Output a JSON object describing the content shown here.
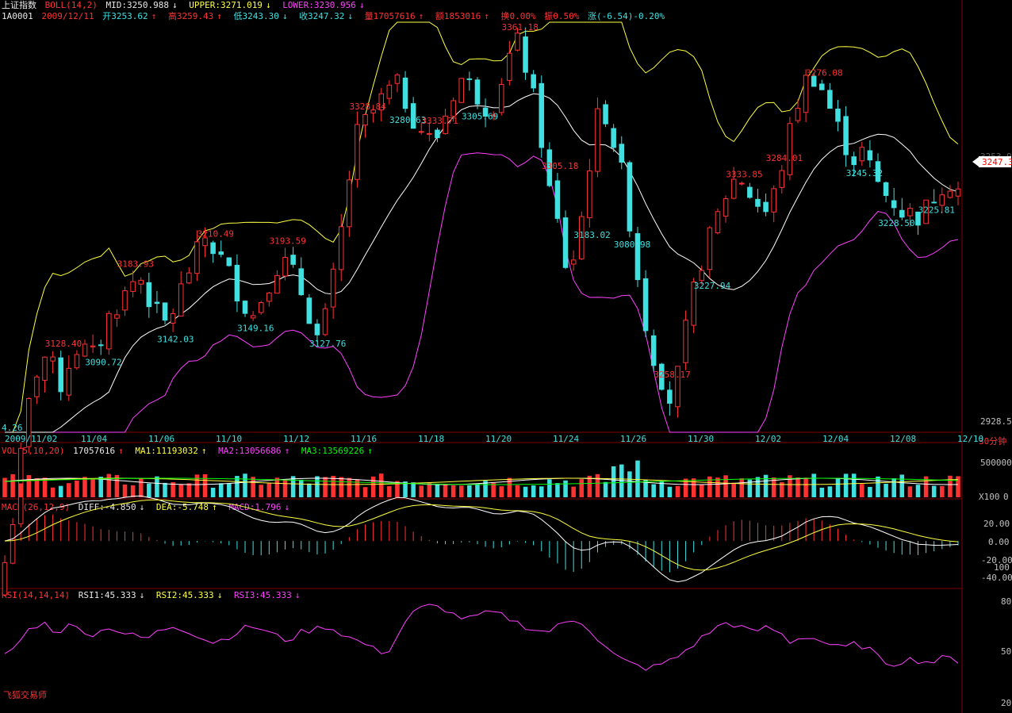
{
  "header1": {
    "name": "上证指数",
    "indicator": "BOLL(14,2)",
    "mid": "MID:3250.988",
    "mid_arrow": "↓",
    "upper": "UPPER:3271.019",
    "upper_arrow": "↓",
    "lower": "LOWER:3230.956",
    "lower_arrow": "↓"
  },
  "header2": {
    "code": "1A0001",
    "date": "2009/12/11",
    "open": "开3253.62",
    "open_arrow": "↑",
    "high": "高3259.43",
    "high_arrow": "↑",
    "low": "低3243.30",
    "low_arrow": "↓",
    "close": "收3247.32",
    "close_arrow": "↓",
    "volume": "量17057616",
    "volume_arrow": "↑",
    "amount": "额1853016",
    "amount_arrow": "↑",
    "turnover": "换0.00%",
    "amplitude": "振0.50%",
    "change": "涨(-6.54)-0.20%"
  },
  "vol_header": {
    "label": "VOL(5,10,20)",
    "value": "17057616",
    "value_arrow": "↑",
    "ma1": "MA1:11193032",
    "ma1_arrow": "↑",
    "ma2": "MA2:13056686",
    "ma2_arrow": "↑",
    "ma3": "MA3:13569226",
    "ma3_arrow": "↑"
  },
  "macd_header": {
    "label": "MACD(26,12,9)",
    "diff": "DIFF:-4.850",
    "diff_arrow": "↓",
    "dea": "DEA:-5.748",
    "dea_arrow": "↑",
    "macd": "MACD:1.796",
    "macd_arrow": "↓"
  },
  "rsi_header": {
    "label": "RSI(14,14,14)",
    "rsi1": "RSI1:45.333",
    "rsi1_arrow": "↓",
    "rsi2": "RSI2:45.333",
    "rsi2_arrow": "↓",
    "rsi3": "RSI3:45.333",
    "rsi3_arrow": "↓"
  },
  "price_axis": {
    "top_label": "3253.9",
    "current": "3247.3",
    "bottom": "2928.5"
  },
  "period_label": "30分钟",
  "vol_axis": [
    "500000",
    "X100",
    "0"
  ],
  "macd_axis": [
    "20.00",
    "0.00",
    "-20.00",
    "100",
    "-40.00"
  ],
  "rsi_axis": [
    "80",
    "50",
    "20"
  ],
  "x_dates": [
    "2009/11/02",
    "11/04",
    "11/06",
    "11/10",
    "11/12",
    "11/16",
    "11/18",
    "11/20",
    "11/24",
    "11/26",
    "11/30",
    "12/02",
    "12/04",
    "12/08",
    "12/10"
  ],
  "annotations": [
    {
      "text": "4.26",
      "color": "#40e0e0"
    },
    {
      "text": "3128.40",
      "color": "#ff3232"
    },
    {
      "text": "3090.72",
      "color": "#40e0e0"
    },
    {
      "text": "3183.93",
      "color": "#ff3232"
    },
    {
      "text": "3142.03",
      "color": "#40e0e0"
    },
    {
      "text": "3210.49",
      "color": "#ff3232"
    },
    {
      "text": "3149.16",
      "color": "#40e0e0"
    },
    {
      "text": "3193.59",
      "color": "#ff3232"
    },
    {
      "text": "3127.76",
      "color": "#40e0e0"
    },
    {
      "text": "3328.84",
      "color": "#ff3232"
    },
    {
      "text": "3280.63",
      "color": "#40e0e0"
    },
    {
      "text": "3333.71",
      "color": "#ff3232"
    },
    {
      "text": "3305.69",
      "color": "#40e0e0"
    },
    {
      "text": "3361.18",
      "color": "#ff3232"
    },
    {
      "text": "3305.18",
      "color": "#ff3232"
    },
    {
      "text": "3183.02",
      "color": "#40e0e0"
    },
    {
      "text": "3080.98",
      "color": "#40e0e0"
    },
    {
      "text": "3258.17",
      "color": "#ff3232"
    },
    {
      "text": "3227.94",
      "color": "#40e0e0"
    },
    {
      "text": "3333.85",
      "color": "#ff3232"
    },
    {
      "text": "3284.01",
      "color": "#ff3232"
    },
    {
      "text": "3276.08",
      "color": "#ff3232"
    },
    {
      "text": "3245.32",
      "color": "#40e0e0"
    },
    {
      "text": "3228.50",
      "color": "#40e0e0"
    },
    {
      "text": "3225.81",
      "color": "#40e0e0"
    }
  ],
  "watermark": "飞狐交易师",
  "colors": {
    "up": "#ff3232",
    "down": "#40e0e0",
    "mid": "#ffffff",
    "upper": "#ffff40",
    "lower": "#ff40ff",
    "grid": "#800000"
  },
  "chart_data": {
    "type": "candlestick",
    "x_unit": "30-minute bars",
    "price_range": [
      2928.5,
      3361.18
    ],
    "close_series": [
      2960,
      3000,
      3060,
      3100,
      3120,
      3110,
      3095,
      3120,
      3128,
      3115,
      3130,
      3150,
      3160,
      3170,
      3183,
      3165,
      3150,
      3142,
      3160,
      3180,
      3195,
      3210,
      3200,
      3190,
      3175,
      3160,
      3149,
      3165,
      3180,
      3193,
      3185,
      3170,
      3150,
      3128,
      3160,
      3200,
      3250,
      3290,
      3300,
      3310,
      3320,
      3328,
      3315,
      3300,
      3290,
      3281,
      3300,
      3320,
      3333,
      3325,
      3315,
      3306,
      3330,
      3350,
      3361,
      3330,
      3300,
      3250,
      3220,
      3183,
      3200,
      3250,
      3300,
      3305,
      3280,
      3250,
      3200,
      3150,
      3120,
      3100,
      3081,
      3120,
      3160,
      3190,
      3210,
      3230,
      3250,
      3258,
      3245,
      3235,
      3228,
      3250,
      3280,
      3310,
      3330,
      3334,
      3320,
      3300,
      3284,
      3270,
      3276,
      3260,
      3245,
      3240,
      3230,
      3228,
      3226,
      3235,
      3250,
      3253,
      3247
    ],
    "rsi_series": [
      48,
      55,
      65,
      68,
      62,
      66,
      64,
      60,
      66,
      62,
      60,
      58,
      63,
      66,
      64,
      60,
      56,
      58,
      62,
      66,
      64,
      60,
      57,
      62,
      64,
      66,
      62,
      58,
      55,
      50,
      52,
      68,
      76,
      78,
      77,
      72,
      70,
      73,
      74,
      71,
      67,
      64,
      62,
      66,
      70,
      68,
      58,
      50,
      45,
      42,
      40,
      43,
      46,
      52,
      58,
      64,
      68,
      66,
      62,
      65,
      63,
      56,
      60,
      58,
      55,
      52,
      55,
      53,
      45,
      43,
      46,
      45,
      44,
      47,
      45
    ],
    "ylim_rsi": [
      20,
      80
    ],
    "ylim_macd": [
      -40,
      20
    ],
    "vol_ylim": [
      0,
      500000
    ]
  }
}
